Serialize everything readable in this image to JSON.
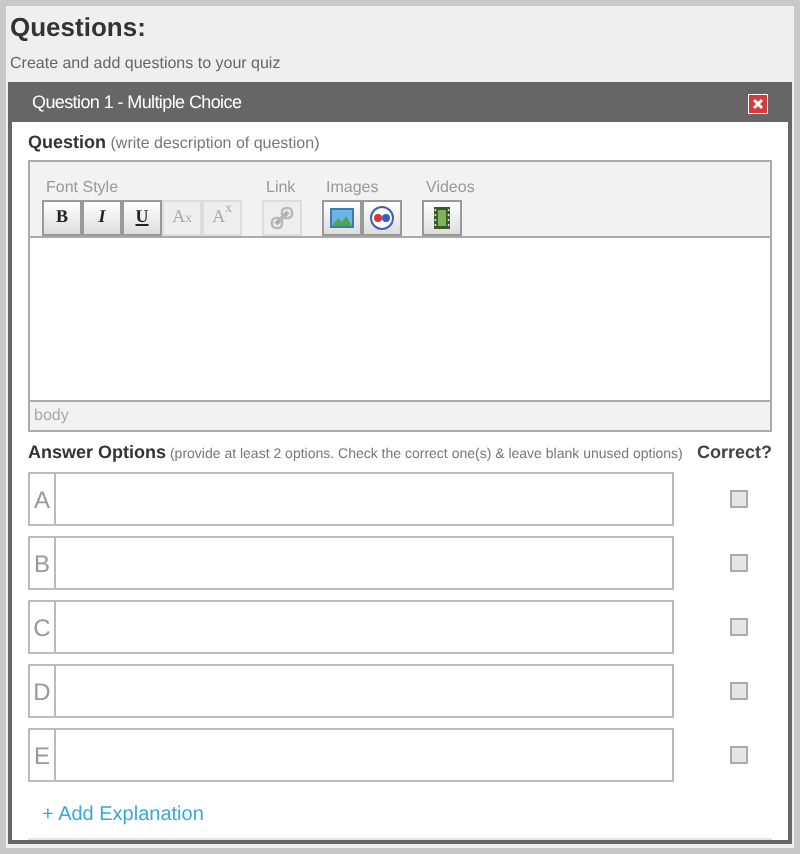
{
  "page": {
    "title": "Questions:",
    "subtitle": "Create and add questions to your quiz"
  },
  "panel": {
    "title": "Question 1 - Multiple Choice",
    "question_label": {
      "label": "Question",
      "hint": "(write description of question)"
    },
    "toolbar": [
      {
        "label": "Font Style",
        "buttons": [
          {
            "kind": "bold",
            "text": "B",
            "disabled": false
          },
          {
            "kind": "italic",
            "text": "I",
            "disabled": false
          },
          {
            "kind": "underline",
            "text": "U",
            "disabled": false
          },
          {
            "kind": "subscript",
            "text": "A$_{x}$",
            "disabled": true
          },
          {
            "kind": "superscript",
            "text": "A$^{x}$",
            "disabled": true
          }
        ]
      },
      {
        "label": "Link",
        "buttons": [
          {
            "kind": "link",
            "disabled": true
          }
        ]
      },
      {
        "label": "Images",
        "buttons": [
          {
            "kind": "image",
            "disabled": false
          },
          {
            "kind": "gallery",
            "disabled": false
          }
        ]
      },
      {
        "label": "Videos",
        "buttons": [
          {
            "kind": "video",
            "disabled": false
          }
        ]
      }
    ],
    "editor_footer": "body",
    "answers_label": {
      "label": "Answer Options",
      "hint": "(provide at least 2 options. Check the correct one(s) & leave blank unused options)"
    },
    "correct_header": "Correct?",
    "options": [
      {
        "letter": "A",
        "checked": false
      },
      {
        "letter": "B",
        "checked": false
      },
      {
        "letter": "C",
        "checked": false
      },
      {
        "letter": "D",
        "checked": false
      },
      {
        "letter": "E",
        "checked": false
      }
    ],
    "add_explanation": "+ Add Explanation"
  }
}
